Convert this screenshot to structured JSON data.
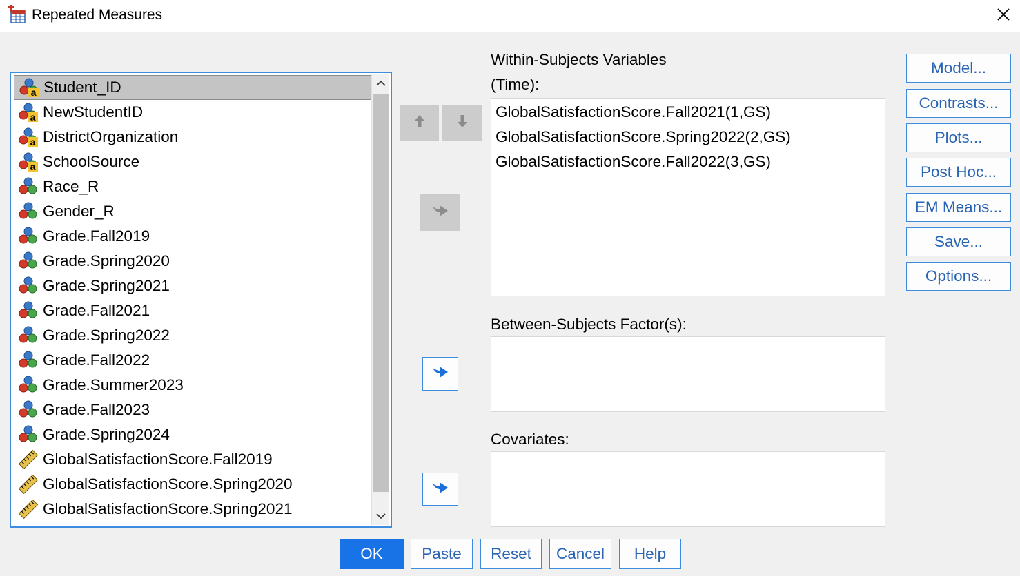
{
  "window": {
    "title": "Repeated Measures",
    "close_icon": "close-icon",
    "title_icon": "repeated-measures-app-icon"
  },
  "variables": [
    {
      "name": "Student_ID",
      "type": "nominal-string",
      "selected": true
    },
    {
      "name": "NewStudentID",
      "type": "nominal-string"
    },
    {
      "name": "DistrictOrganization",
      "type": "nominal-string"
    },
    {
      "name": "SchoolSource",
      "type": "nominal-string"
    },
    {
      "name": "Race_R",
      "type": "nominal"
    },
    {
      "name": "Gender_R",
      "type": "nominal"
    },
    {
      "name": "Grade.Fall2019",
      "type": "nominal"
    },
    {
      "name": "Grade.Spring2020",
      "type": "nominal"
    },
    {
      "name": "Grade.Spring2021",
      "type": "nominal"
    },
    {
      "name": "Grade.Fall2021",
      "type": "nominal"
    },
    {
      "name": "Grade.Spring2022",
      "type": "nominal"
    },
    {
      "name": "Grade.Fall2022",
      "type": "nominal"
    },
    {
      "name": "Grade.Summer2023",
      "type": "nominal"
    },
    {
      "name": "Grade.Fall2023",
      "type": "nominal"
    },
    {
      "name": "Grade.Spring2024",
      "type": "nominal"
    },
    {
      "name": "GlobalSatisfactionScore.Fall2019",
      "type": "scale"
    },
    {
      "name": "GlobalSatisfactionScore.Spring2020",
      "type": "scale"
    },
    {
      "name": "GlobalSatisfactionScore.Spring2021",
      "type": "scale"
    }
  ],
  "within_subjects": {
    "label": "Within-Subjects Variables",
    "factor": "(Time):",
    "items": [
      "GlobalSatisfactionScore.Fall2021(1,GS)",
      "GlobalSatisfactionScore.Spring2022(2,GS)",
      "GlobalSatisfactionScore.Fall2022(3,GS)"
    ]
  },
  "between_subjects": {
    "label": "Between-Subjects Factor(s):"
  },
  "covariates": {
    "label": "Covariates:"
  },
  "side_buttons": {
    "model": "Model...",
    "contrasts": "Contrasts...",
    "plots": "Plots...",
    "post_hoc": "Post Hoc...",
    "em_means": "EM Means...",
    "save": "Save...",
    "options": "Options..."
  },
  "bottom_buttons": {
    "ok": "OK",
    "paste": "Paste",
    "reset": "Reset",
    "cancel": "Cancel",
    "help": "Help"
  },
  "colors": {
    "accent": "#3c8ce0",
    "primary_button": "#1874e6",
    "link_text": "#2a64b4",
    "selection": "#c4c4c4"
  }
}
